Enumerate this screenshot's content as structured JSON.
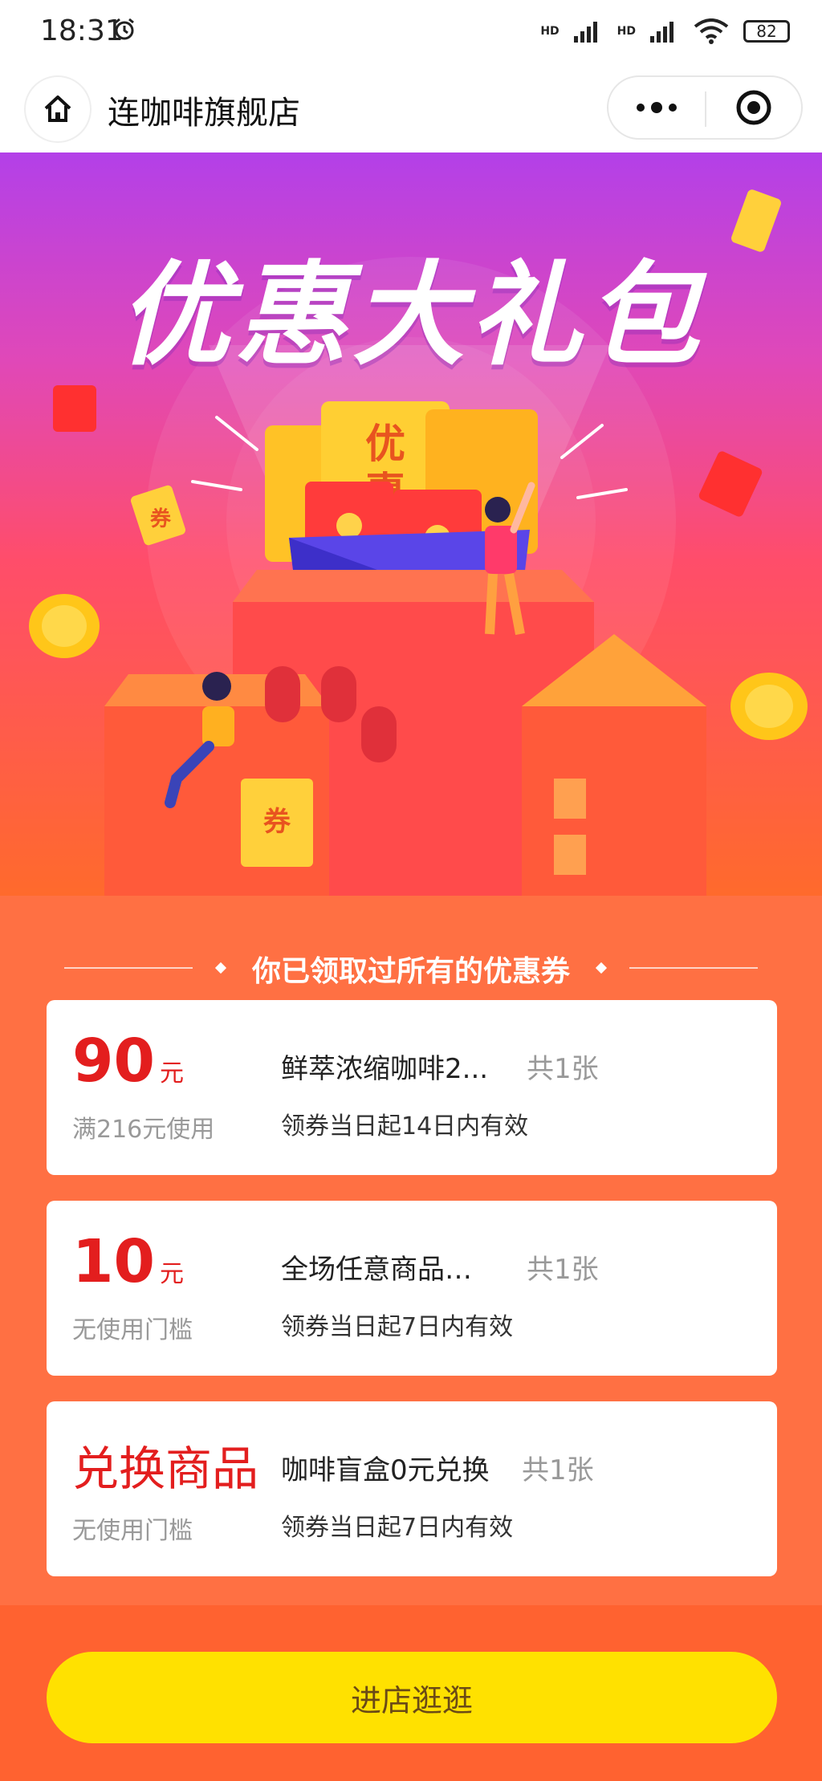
{
  "status_bar": {
    "time": "18:31",
    "hd_1": "HD",
    "hd_2": "HD",
    "battery": "82"
  },
  "header": {
    "title": "连咖啡旗舰店"
  },
  "hero": {
    "title": "优惠大礼包",
    "envelope_text_1": "优",
    "envelope_text_2": "惠",
    "ticket_text_1": "券",
    "ticket_text_2": "券"
  },
  "coupons_section": {
    "title": "你已领取过所有的优惠券"
  },
  "coupons": [
    {
      "amount": "90",
      "unit": "元",
      "condition": "满216元使用",
      "name": "鲜萃浓缩咖啡2...",
      "count": "共1张",
      "validity": "领券当日起14日内有效"
    },
    {
      "amount": "10",
      "unit": "元",
      "condition": "无使用门槛",
      "name": "全场任意商品立...",
      "count": "共1张",
      "validity": "领券当日起7日内有效"
    },
    {
      "amount": "兑换商品",
      "unit": "",
      "condition": "无使用门槛",
      "name": "咖啡盲盒0元兑换",
      "count": "共1张",
      "validity": "领券当日起7日内有效"
    }
  ],
  "footer": {
    "button_label": "进店逛逛"
  },
  "colors": {
    "accent_red": "#e31e1e",
    "button_yellow": "#ffe100",
    "coupon_bg": "#ff7043"
  }
}
